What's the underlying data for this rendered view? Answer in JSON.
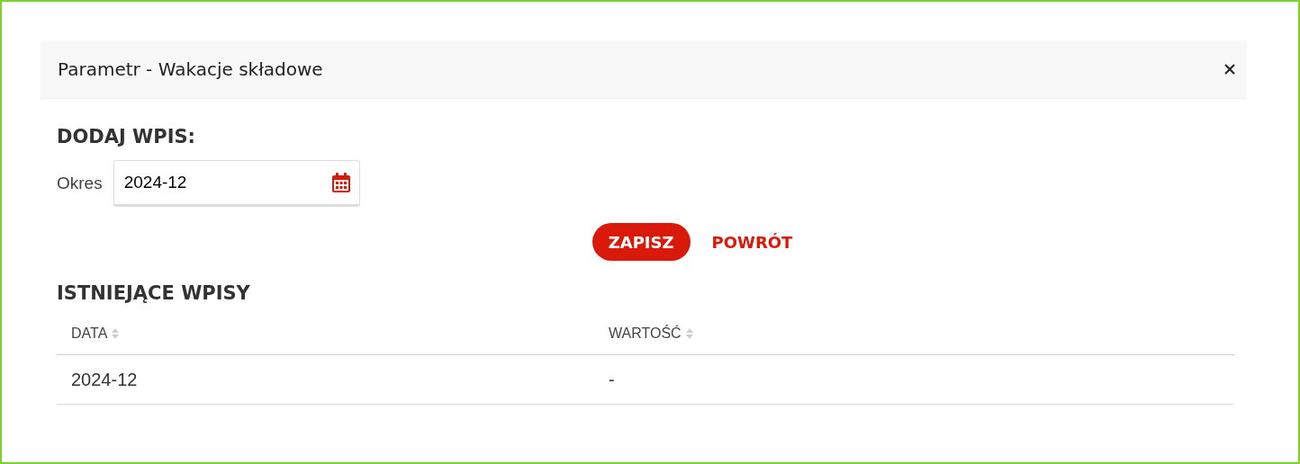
{
  "dialog": {
    "title": "Parametr - Wakacje składowe"
  },
  "add_section": {
    "heading": "DODAJ WPIS:",
    "field_label": "Okres",
    "field_value": "2024-12"
  },
  "buttons": [
    {
      "label": "ZAPISZ",
      "kind": "primary"
    },
    {
      "label": "POWRÓT",
      "kind": "link"
    }
  ],
  "existing_section": {
    "heading": "ISTNIEJĄCE WPISY"
  },
  "table": {
    "columns": [
      "DATA",
      "WARTOŚĆ"
    ],
    "rows": [
      [
        "2024-12",
        "-"
      ]
    ]
  }
}
